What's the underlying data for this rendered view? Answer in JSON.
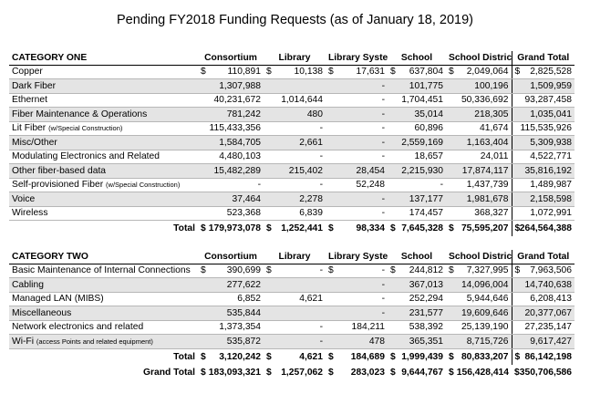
{
  "title": "Pending FY2018 Funding Requests (as of January 18, 2019)",
  "columns": [
    "Consortium",
    "Library",
    "Library System",
    "School",
    "School District",
    "Grand Total"
  ],
  "category_one": {
    "heading": "CATEGORY ONE",
    "rows": [
      {
        "name": "Copper",
        "note": "",
        "values": [
          "110,891",
          "10,138",
          "17,631",
          "637,804",
          "2,049,064",
          "2,825,528"
        ],
        "dollar": true
      },
      {
        "name": "Dark Fiber",
        "note": "",
        "values": [
          "1,307,988",
          "",
          "-",
          "101,775",
          "100,196",
          "1,509,959"
        ]
      },
      {
        "name": "Ethernet",
        "note": "",
        "values": [
          "40,231,672",
          "1,014,644",
          "-",
          "1,704,451",
          "50,336,692",
          "93,287,458"
        ]
      },
      {
        "name": "Fiber Maintenance & Operations",
        "note": "",
        "values": [
          "781,242",
          "480",
          "-",
          "35,014",
          "218,305",
          "1,035,041"
        ]
      },
      {
        "name": "Lit Fiber",
        "note": "(w/Special Construction)",
        "values": [
          "115,433,356",
          "-",
          "-",
          "60,896",
          "41,674",
          "115,535,926"
        ]
      },
      {
        "name": "Misc/Other",
        "note": "",
        "values": [
          "1,584,705",
          "2,661",
          "-",
          "2,559,169",
          "1,163,404",
          "5,309,938"
        ]
      },
      {
        "name": "Modulating Electronics and Related",
        "note": "",
        "values": [
          "4,480,103",
          "-",
          "-",
          "18,657",
          "24,011",
          "4,522,771"
        ]
      },
      {
        "name": "Other fiber-based data",
        "note": "",
        "values": [
          "15,482,289",
          "215,402",
          "28,454",
          "2,215,930",
          "17,874,117",
          "35,816,192"
        ]
      },
      {
        "name": "Self-provisioned Fiber",
        "note": "(w/Special Construction)",
        "values": [
          "-",
          "-",
          "52,248",
          "-",
          "1,437,739",
          "1,489,987"
        ]
      },
      {
        "name": "Voice",
        "note": "",
        "values": [
          "37,464",
          "2,278",
          "-",
          "137,177",
          "1,981,678",
          "2,158,598"
        ]
      },
      {
        "name": "Wireless",
        "note": "",
        "values": [
          "523,368",
          "6,839",
          "-",
          "174,457",
          "368,327",
          "1,072,991"
        ]
      }
    ],
    "total_label": "Total",
    "total": [
      "179,973,078",
      "1,252,441",
      "98,334",
      "7,645,328",
      "75,595,207",
      "264,564,388"
    ]
  },
  "category_two": {
    "heading": "CATEGORY TWO",
    "rows": [
      {
        "name": "Basic Maintenance of Internal Connections",
        "note": "",
        "values": [
          "390,699",
          "-",
          "-",
          "244,812",
          "7,327,995",
          "7,963,506"
        ],
        "dollar": true
      },
      {
        "name": "Cabling",
        "note": "",
        "values": [
          "277,622",
          "",
          "-",
          "367,013",
          "14,096,004",
          "14,740,638"
        ]
      },
      {
        "name": "Managed LAN (MIBS)",
        "note": "",
        "values": [
          "6,852",
          "4,621",
          "-",
          "252,294",
          "5,944,646",
          "6,208,413"
        ]
      },
      {
        "name": "Miscellaneous",
        "note": "",
        "values": [
          "535,844",
          "",
          "-",
          "231,577",
          "19,609,646",
          "20,377,067"
        ]
      },
      {
        "name": "Network electronics and related",
        "note": "",
        "values": [
          "1,373,354",
          "-",
          "184,211",
          "538,392",
          "25,139,190",
          "27,235,147"
        ]
      },
      {
        "name": "Wi-Fi",
        "note": "(access Points and related equipment)",
        "values": [
          "535,872",
          "-",
          "478",
          "365,351",
          "8,715,726",
          "9,617,427"
        ]
      }
    ],
    "total_label": "Total",
    "total": [
      "3,120,242",
      "4,621",
      "184,689",
      "1,999,439",
      "80,833,207",
      "86,142,198"
    ]
  },
  "grand_total_label": "Grand Total",
  "grand_total": [
    "183,093,321",
    "1,257,062",
    "283,023",
    "9,644,767",
    "156,428,414",
    "350,706,586"
  ]
}
